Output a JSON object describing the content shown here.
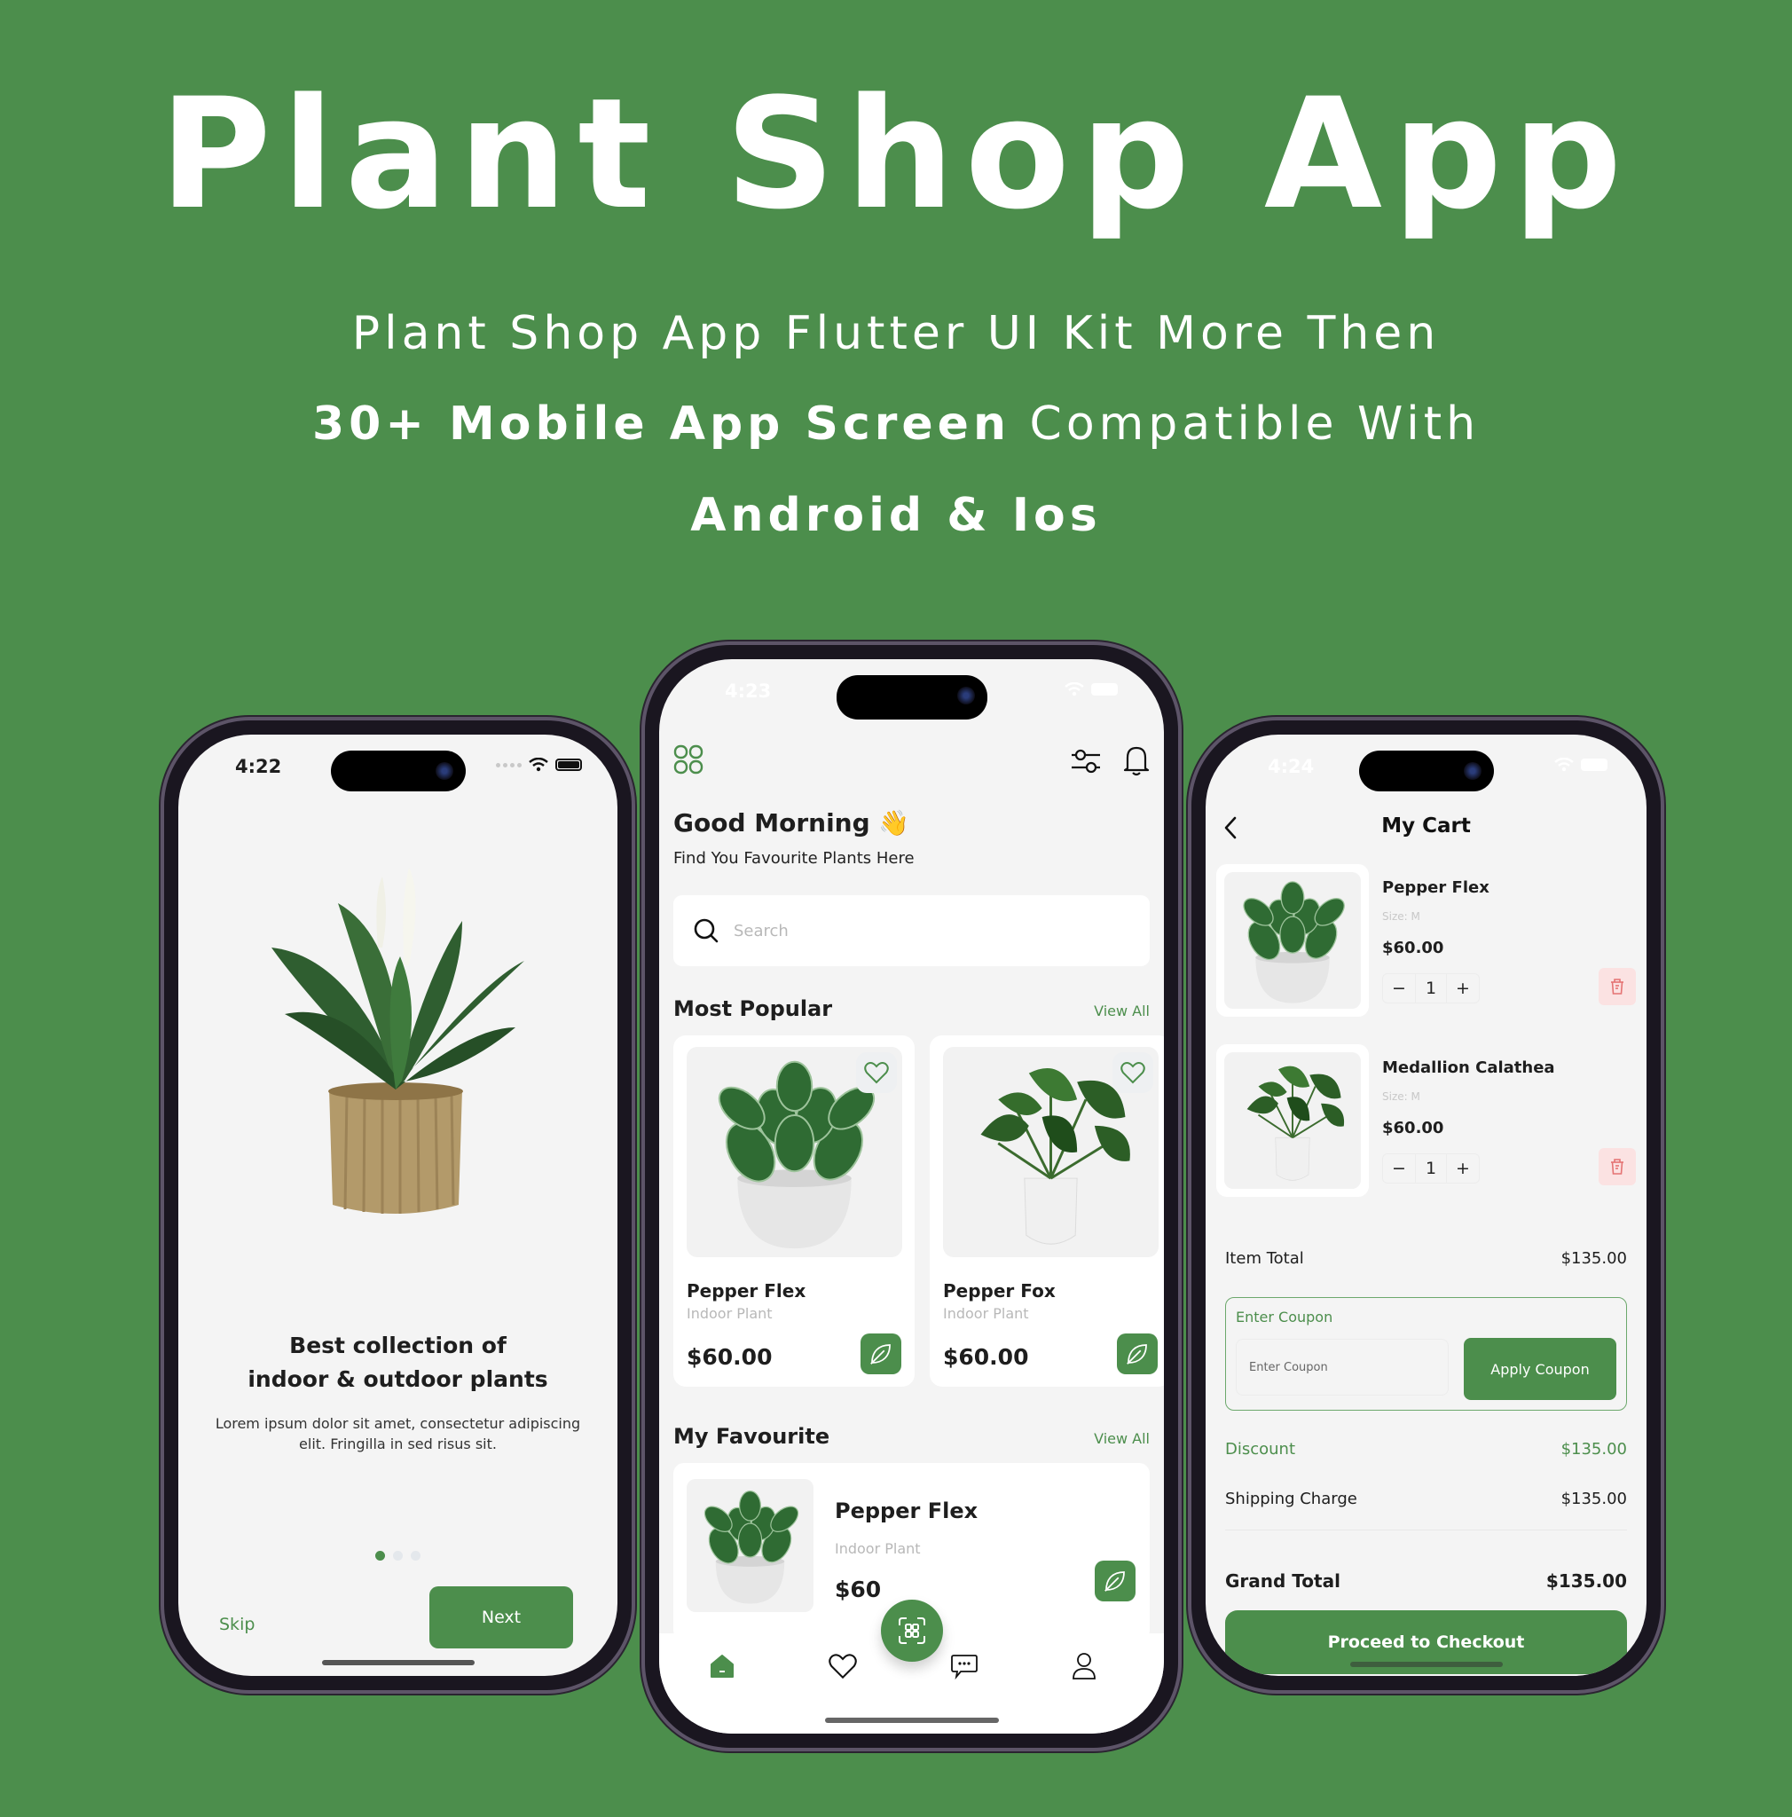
{
  "hero": {
    "title": "Plant Shop App",
    "subtitle_line1": "Plant Shop App Flutter UI Kit More Then",
    "subtitle_line2_bold": "30+ Mobile App Screen",
    "subtitle_line2_rest": " Compatible With",
    "subtitle_line3": "Android & Ios"
  },
  "colors": {
    "brand_green": "#4c8e4c",
    "background": "#f4f4f4",
    "delete_bg": "#fbe2e2",
    "delete_icon": "#e57373"
  },
  "onboarding": {
    "status_time": "4:22",
    "title_line1": "Best collection of",
    "title_line2": "indoor & outdoor plants",
    "description": "Lorem ipsum dolor sit amet, consectetur adipiscing elit. Fringilla in sed risus sit.",
    "page_count": 3,
    "active_page": 1,
    "skip_label": "Skip",
    "next_label": "Next"
  },
  "home": {
    "status_time": "4:23",
    "greeting": "Good Morning 👋",
    "greeting_sub": "Find You Favourite Plants Here",
    "search_placeholder": "Search",
    "most_popular": {
      "title": "Most Popular",
      "view_all": "View All",
      "items": [
        {
          "name": "Pepper Flex",
          "type": "Indoor Plant",
          "price": "$60.00"
        },
        {
          "name": "Pepper Fox",
          "type": "Indoor Plant",
          "price": "$60.00"
        }
      ]
    },
    "my_favourite": {
      "title": "My Favourite",
      "view_all": "View All",
      "items": [
        {
          "name": "Pepper Flex",
          "type": "Indoor Plant",
          "price": "$60"
        }
      ]
    },
    "nav": [
      "home-icon",
      "heart-icon",
      "scan-icon",
      "chat-icon",
      "profile-icon"
    ],
    "active_nav": "home"
  },
  "cart": {
    "status_time": "4:24",
    "title": "My Cart",
    "items": [
      {
        "name": "Pepper Flex",
        "size": "Size: M",
        "price": "$60.00",
        "qty": "1"
      },
      {
        "name": "Medallion Calathea",
        "size": "Size: M",
        "price": "$60.00",
        "qty": "1"
      }
    ],
    "item_total_label": "Item Total",
    "item_total": "$135.00",
    "coupon_label": "Enter Coupon",
    "coupon_placeholder": "Enter Coupon",
    "apply_label": "Apply Coupon",
    "discount_label": "Discount",
    "discount": "$135.00",
    "shipping_label": "Shipping Charge",
    "shipping": "$135.00",
    "grand_total_label": "Grand Total",
    "grand_total": "$135.00",
    "checkout_label": "Proceed to Checkout"
  }
}
